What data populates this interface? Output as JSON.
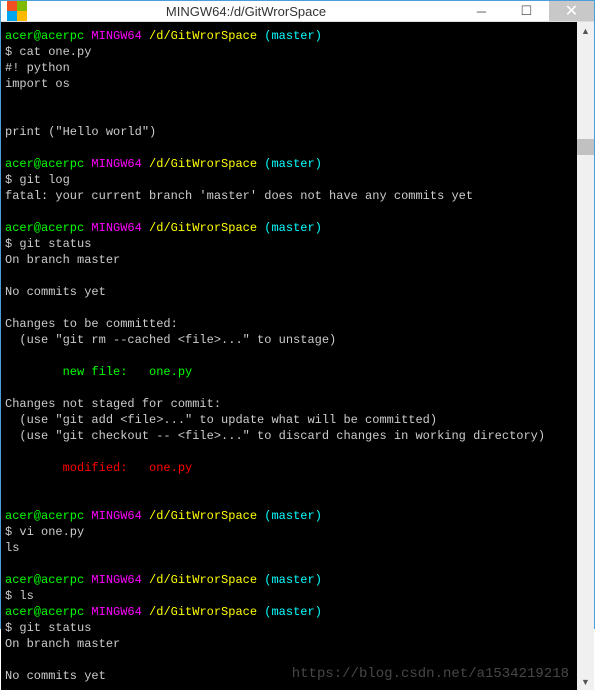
{
  "window": {
    "title": "MINGW64:/d/GitWrorSpace"
  },
  "prompt": {
    "user_host": "acer@acerpc",
    "shell": "MINGW64",
    "path": "/d/GitWrorSpace",
    "branch": "(master)"
  },
  "lines": {
    "cmd_cat": "$ cat one.py",
    "shebang": "#! python",
    "import": "import os",
    "print": "print (\"Hello world\")",
    "cmd_gitlog": "$ git log",
    "fatal": "fatal: your current branch 'master' does not have any commits yet",
    "cmd_gitstatus": "$ git status",
    "on_branch": "On branch master",
    "no_commits": "No commits yet",
    "changes_committed": "Changes to be committed:",
    "unstage_hint": "  (use \"git rm --cached <file>...\" to unstage)",
    "new_file": "        new file:   one.py",
    "changes_not_staged": "Changes not staged for commit:",
    "add_hint": "  (use \"git add <file>...\" to update what will be committed)",
    "checkout_hint": "  (use \"git checkout -- <file>...\" to discard changes in working directory)",
    "modified": "        modified:   one.py",
    "cmd_vi": "$ vi one.py",
    "ls_stray": "ls",
    "cmd_ls": "$ ls",
    "cmd_gitstatus2": "$ git status"
  },
  "watermark": "https://blog.csdn.net/a1534219218"
}
